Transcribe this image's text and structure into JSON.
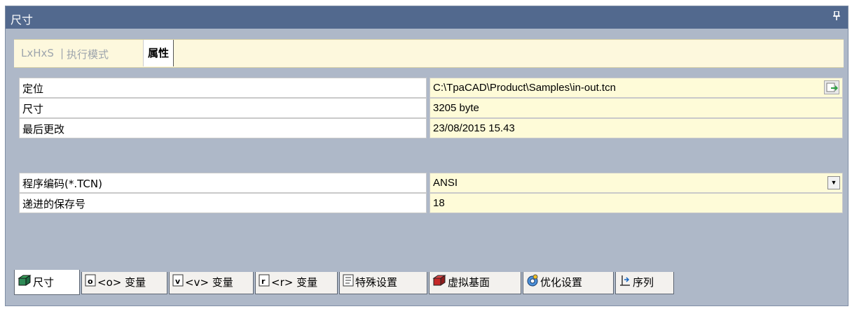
{
  "panel": {
    "title": "尺寸",
    "pin_glyph": "ᵩ"
  },
  "top_tabs": [
    {
      "label": "LxHxS"
    },
    {
      "label": "执行模式"
    },
    {
      "label": "属性"
    }
  ],
  "top_tab_separator": "|",
  "properties": [
    {
      "label": "定位",
      "value": "C:\\TpaCAD\\Product\\Samples\\in-out.tcn"
    },
    {
      "label": "尺寸",
      "value": "3205 byte"
    },
    {
      "label": "最后更改",
      "value": "23/08/2015 15.43"
    },
    {
      "label": "程序编码(*.TCN)",
      "value": "ANSI"
    },
    {
      "label": "递进的保存号",
      "value": "18"
    }
  ],
  "bottom_tabs": [
    {
      "label": "尺寸",
      "icon": "box-icon"
    },
    {
      "label": "<o> 变量",
      "icon": "variable-o-icon"
    },
    {
      "label": "<v> 变量",
      "icon": "variable-v-icon"
    },
    {
      "label": "<r> 变量",
      "icon": "variable-r-icon"
    },
    {
      "label": "特殊设置",
      "icon": "list-icon"
    },
    {
      "label": "虚拟基面",
      "icon": "red-cube-icon"
    },
    {
      "label": "优化设置",
      "icon": "optimize-icon"
    },
    {
      "label": "序列",
      "icon": "sequence-icon"
    }
  ],
  "colors": {
    "title_bar": "#52698e",
    "panel_bg": "#aeb8c8",
    "value_bg": "#fefbd8",
    "tabstrip_bg": "#fdf8dd"
  }
}
